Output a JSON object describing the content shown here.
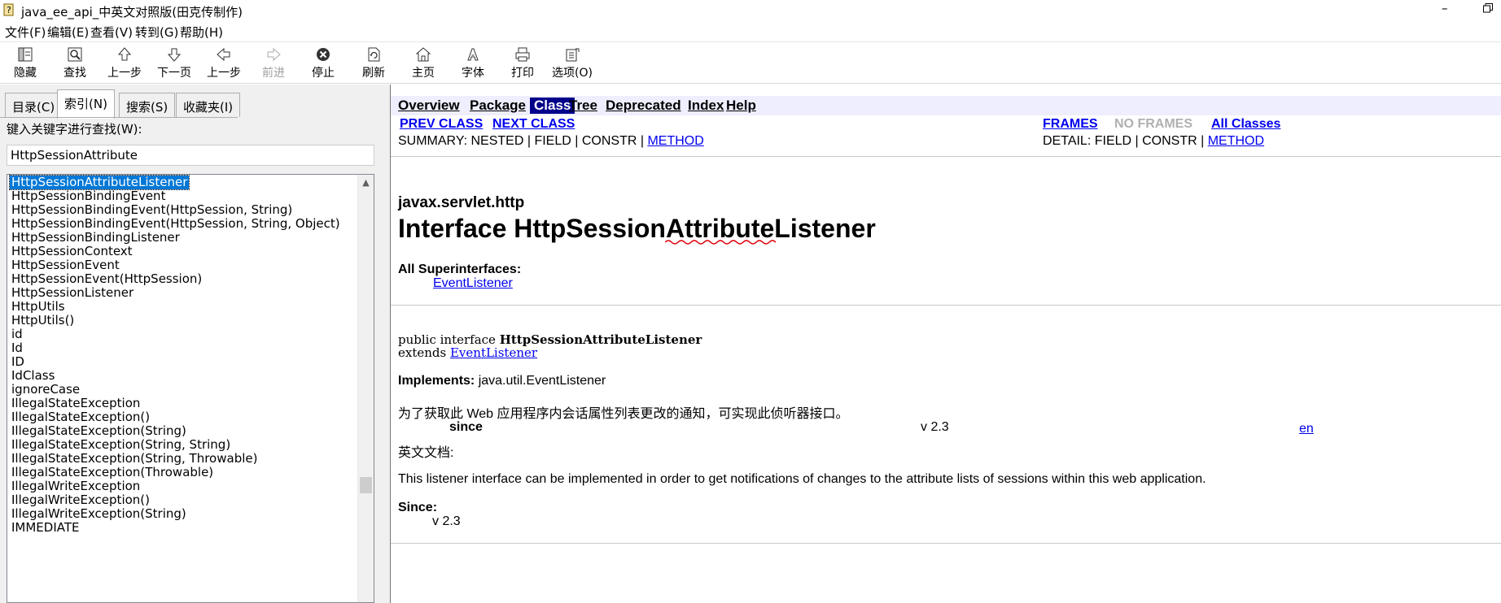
{
  "window": {
    "title": "java_ee_api_中英文对照版(田克传制作)",
    "minimize": "–"
  },
  "menu": [
    "文件(F)",
    "编辑(E)",
    "查看(V)",
    "转到(G)",
    "帮助(H)"
  ],
  "toolbar": [
    {
      "label": "隐藏",
      "icon": "hide-icon",
      "enabled": true
    },
    {
      "label": "查找",
      "icon": "find-icon",
      "enabled": true
    },
    {
      "label": "上一步",
      "icon": "arrow-up-icon",
      "enabled": true
    },
    {
      "label": "下一页",
      "icon": "arrow-down-icon",
      "enabled": true
    },
    {
      "label": "上一步",
      "icon": "arrow-left-icon",
      "enabled": true
    },
    {
      "label": "前进",
      "icon": "arrow-right-icon",
      "enabled": false
    },
    {
      "label": "停止",
      "icon": "stop-icon",
      "enabled": true
    },
    {
      "label": "刷新",
      "icon": "refresh-icon",
      "enabled": true
    },
    {
      "label": "主页",
      "icon": "home-icon",
      "enabled": true
    },
    {
      "label": "字体",
      "icon": "font-icon",
      "enabled": true
    },
    {
      "label": "打印",
      "icon": "print-icon",
      "enabled": true
    },
    {
      "label": "选项(O)",
      "icon": "options-icon",
      "enabled": true
    }
  ],
  "left": {
    "tabs": [
      "目录(C)",
      "索引(N)",
      "搜索(S)",
      "收藏夹(I)"
    ],
    "active_tab": 1,
    "keyword_label": "键入关键字进行查找(W):",
    "search_value": "HttpSessionAttribute",
    "selected_index": 0,
    "items": [
      "HttpSessionAttributeListener",
      "HttpSessionBindingEvent",
      "HttpSessionBindingEvent(HttpSession, String)",
      "HttpSessionBindingEvent(HttpSession, String, Object)",
      "HttpSessionBindingListener",
      "HttpSessionContext",
      "HttpSessionEvent",
      "HttpSessionEvent(HttpSession)",
      "HttpSessionListener",
      "HttpUtils",
      "HttpUtils()",
      "id",
      "Id",
      "ID",
      "IdClass",
      "ignoreCase",
      "IllegalStateException",
      "IllegalStateException()",
      "IllegalStateException(String)",
      "IllegalStateException(String, String)",
      "IllegalStateException(String, Throwable)",
      "IllegalStateException(Throwable)",
      "IllegalWriteException",
      "IllegalWriteException()",
      "IllegalWriteException(String)",
      "IMMEDIATE"
    ]
  },
  "doc": {
    "nav": [
      "Overview",
      "Package",
      "Class",
      "Tree",
      "Deprecated",
      "Index",
      "Help"
    ],
    "nav_current": "Class",
    "prev_class": "PREV CLASS",
    "next_class": "NEXT CLASS",
    "frames": "FRAMES",
    "no_frames": "NO FRAMES",
    "all_classes": "All Classes",
    "summary_prefix": "SUMMARY: NESTED | FIELD | CONSTR | ",
    "summary_method": "METHOD",
    "detail_prefix": "DETAIL: FIELD | CONSTR | ",
    "detail_method": "METHOD",
    "package": "javax.servlet.http",
    "title": "Interface HttpSessionAttributeListener",
    "superinterfaces_label": "All Superinterfaces:",
    "superinterface": "EventListener",
    "decl_prefix": "public interface ",
    "decl_name": "HttpSessionAttributeListener",
    "extends_prefix": "extends ",
    "extends_link": "EventListener",
    "implements_label": "Implements:",
    "implements_value": "java.util.EventListener",
    "cn_description": "为了获取此 Web 应用程序内会话属性列表更改的通知，可实现此侦听器接口。",
    "since_label": "since",
    "since_value": "v 2.3",
    "en_link": "en",
    "en_doc_label": "英文文档:",
    "en_description": "This listener interface can be implemented in order to get notifications of changes to the attribute lists of sessions within this web application.",
    "since_label2": "Since:",
    "since_value2": "v 2.3"
  }
}
